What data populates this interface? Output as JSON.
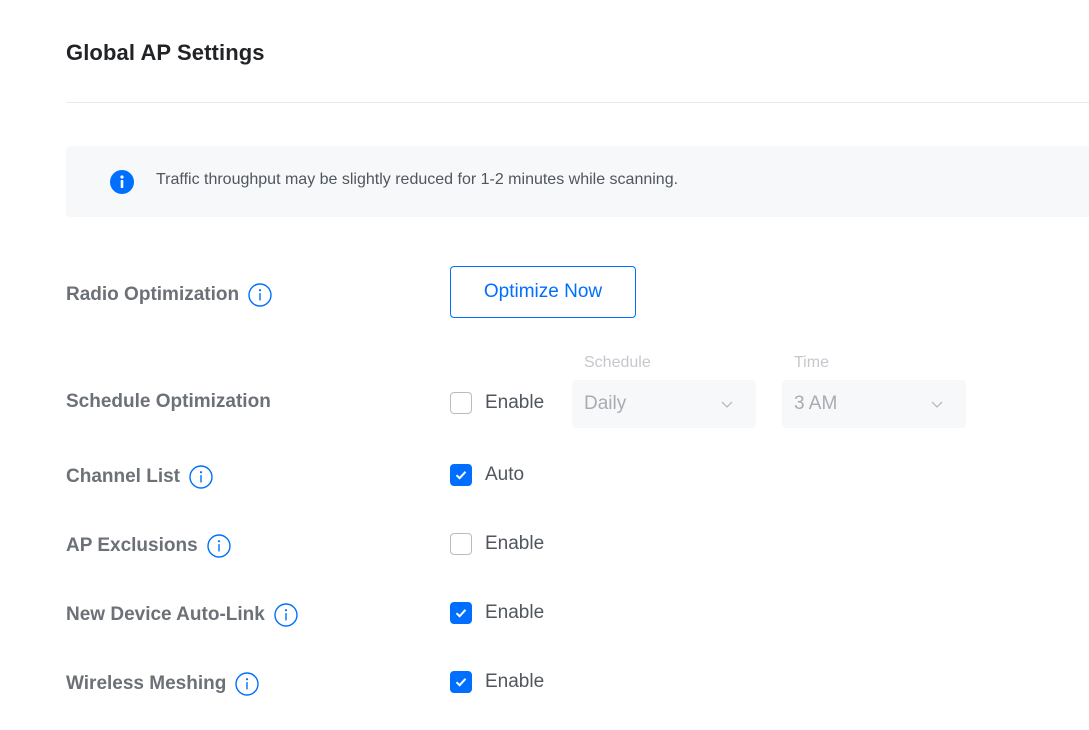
{
  "header": {
    "title": "Global AP Settings"
  },
  "banner": {
    "icon": "info-filled-icon",
    "text": "Traffic throughput may be slightly reduced for 1-2 minutes while scanning."
  },
  "settings": {
    "radio_optimization": {
      "label": "Radio Optimization",
      "button_label": "Optimize Now"
    },
    "schedule_optimization": {
      "label": "Schedule Optimization",
      "enable_label": "Enable",
      "checked": false,
      "schedule_label": "Schedule",
      "schedule_value": "Daily",
      "time_label": "Time",
      "time_value": "3 AM"
    },
    "channel_list": {
      "label": "Channel List",
      "option_label": "Auto",
      "checked": true
    },
    "ap_exclusions": {
      "label": "AP Exclusions",
      "option_label": "Enable",
      "checked": false
    },
    "new_device_auto_link": {
      "label": "New Device Auto-Link",
      "option_label": "Enable",
      "checked": true
    },
    "wireless_meshing": {
      "label": "Wireless Meshing",
      "option_label": "Enable",
      "checked": true
    }
  },
  "colors": {
    "accent": "#006fff",
    "title": "#212327",
    "label": "#6c7178",
    "text": "#50565e",
    "banner_bg": "#f7f8f9",
    "disabled_text": "#a8acb2"
  }
}
